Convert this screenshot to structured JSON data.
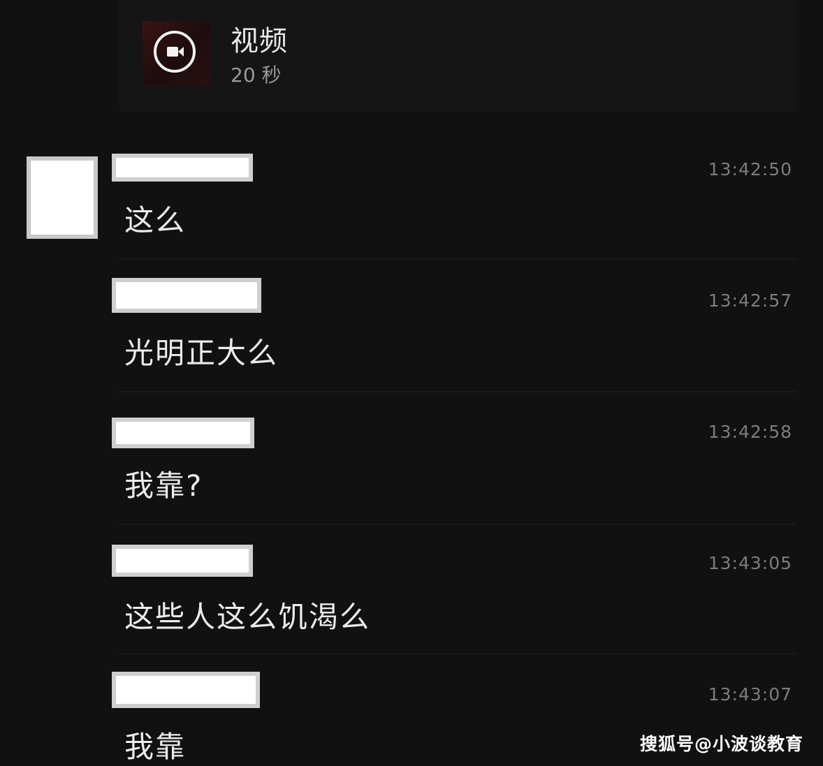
{
  "video": {
    "title": "视频",
    "duration": "20 秒",
    "icon": "video-camera-icon"
  },
  "messages": [
    {
      "text": "这么",
      "time": "13:42:50"
    },
    {
      "text": "光明正大么",
      "time": "13:42:57"
    },
    {
      "text": "我靠?",
      "time": "13:42:58"
    },
    {
      "text": "这些人这么饥渴么",
      "time": "13:43:05"
    },
    {
      "text": "我靠",
      "time": "13:43:07"
    }
  ],
  "watermark": "搜狐号@小波谈教育"
}
